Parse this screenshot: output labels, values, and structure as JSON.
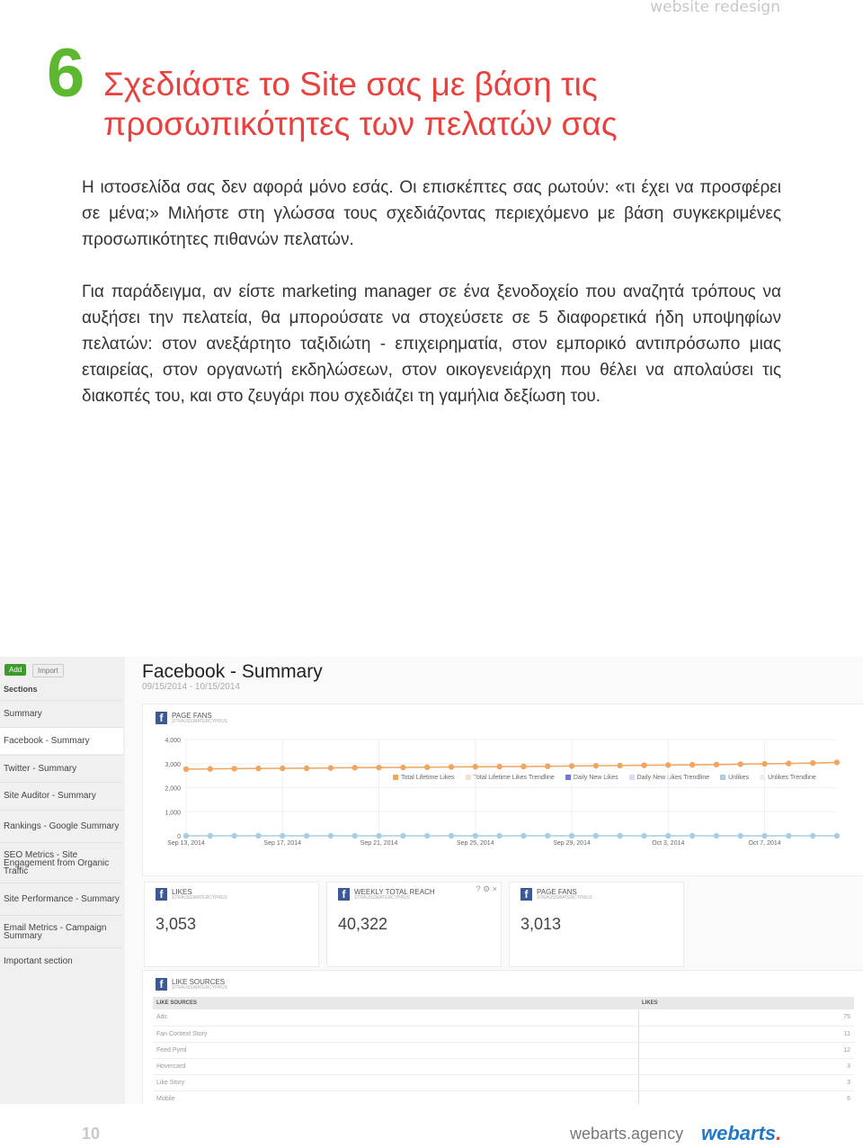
{
  "header": {
    "running_title": "website redesign"
  },
  "section": {
    "number": "6",
    "title": "Σχεδιάστε το Site σας με βάση τις προσωπικότητες των πελατών σας"
  },
  "paragraphs": [
    "Η ιστοσελίδα σας δεν αφορά μόνο εσάς. Οι επισκέπτες σας ρωτούν: «τι έχει να προσφέρει σε μένα;» Μιλήστε στη γλώσσα τους σχεδιάζοντας περιεχόμενο με βάση συγκεκριμένες προσωπικότητες πιθανών πελατών.",
    "Για παράδειγμα, αν είστε marketing manager σε ένα ξενοδοχείο που αναζητά τρόπους να αυξήσει την πελατεία, θα μπορούσατε να στοχεύσετε σε 5 διαφορετικά ήδη υποψηφίων πελατών: στον ανεξάρτητο ταξιδιώτη - επιχειρηματία, στον εμπορικό αντιπρόσωπο μιας εταιρείας, στον οργανωτή εκδηλώσεων, στον οικογενειάρχη που θέλει να απολαύσει τις διακοπές του, και στο ζευγάρι που σχεδιάζει τη γαμήλια δεξίωση του."
  ],
  "screenshot": {
    "sidebar": {
      "add_label": "Add",
      "import_label": "Import",
      "sections_label": "Sections",
      "items": [
        "Summary",
        "Facebook - Summary",
        "Twitter - Summary",
        "Site Auditor - Summary",
        "Rankings - Google Summary",
        "SEO Metrics - Site Engagement from Organic Traffic",
        "Site Performance - Summary",
        "Email Metrics - Campaign Summary",
        "Important section"
      ],
      "active": 1
    },
    "page_title": "Facebook - Summary",
    "date_range": "09/15/2014 - 10/15/2014",
    "account": "STRAUSSWATERCYPRUS",
    "chart_card_title": "PAGE FANS",
    "cards": [
      {
        "title": "LIKES",
        "value": "3,053"
      },
      {
        "title": "WEEKLY TOTAL REACH",
        "value": "40,322"
      },
      {
        "title": "PAGE FANS",
        "value": "3,013"
      }
    ],
    "card_icons": [
      "help-icon",
      "gear-icon",
      "close-icon"
    ],
    "table": {
      "title": "LIKE SOURCES",
      "columns": [
        "LIKE SOURCES",
        "LIKES"
      ],
      "rows": [
        [
          "Ads",
          "75"
        ],
        [
          "Fan Context Story",
          "11"
        ],
        [
          "Feed Pyml",
          "12"
        ],
        [
          "Hovercard",
          "3"
        ],
        [
          "Like Story",
          "3"
        ],
        [
          "Mobile",
          "6"
        ]
      ]
    },
    "chart_data": {
      "type": "line",
      "ylim": [
        0,
        4000
      ],
      "y_ticks": [
        "0",
        "1,000",
        "2,000",
        "3,000",
        "4,000"
      ],
      "x_ticks": [
        "Sep 13, 2014",
        "Sep 17, 2014",
        "Sep 21, 2014",
        "Sep 25, 2014",
        "Sep 29, 2014",
        "Oct 3, 2014",
        "Oct 7, 2014"
      ],
      "x_start": "2014-09-13",
      "x_end": "2014-10-10",
      "grid": true,
      "legend_position": "top-right",
      "legend": [
        {
          "name": "Total Lifetime Likes",
          "color": "#f0a560"
        },
        {
          "name": "Total Lifetime Likes Trendline",
          "color": "#f8e0cc"
        },
        {
          "name": "Daily New Likes",
          "color": "#7b74d9"
        },
        {
          "name": "Daily New Likes Trendline",
          "color": "#dcd9f4"
        },
        {
          "name": "Unlikes",
          "color": "#a9cde3"
        },
        {
          "name": "Unlikes Trendline",
          "color": "#e4eff6"
        }
      ],
      "series": [
        {
          "name": "Total Lifetime Likes",
          "color": "#f0a560",
          "values": [
            2770,
            2780,
            2790,
            2800,
            2805,
            2810,
            2820,
            2830,
            2835,
            2840,
            2850,
            2860,
            2870,
            2875,
            2880,
            2890,
            2900,
            2910,
            2920,
            2930,
            2940,
            2950,
            2960,
            2975,
            2990,
            3005,
            3025,
            3050
          ]
        },
        {
          "name": "Unlikes",
          "color": "#a9cde3",
          "values": [
            0,
            0,
            0,
            0,
            0,
            0,
            0,
            0,
            0,
            0,
            0,
            0,
            0,
            0,
            0,
            0,
            0,
            0,
            0,
            0,
            0,
            0,
            0,
            0,
            0,
            0,
            0,
            0
          ]
        }
      ]
    }
  },
  "footer": {
    "page_number": "10",
    "site": "webarts.agency",
    "logo": "webarts."
  }
}
